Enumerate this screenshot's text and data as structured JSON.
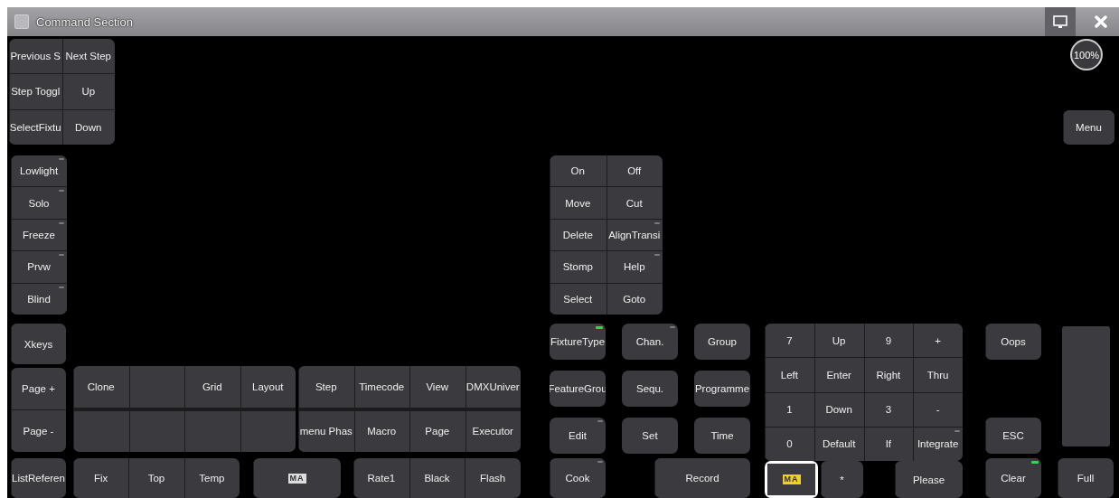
{
  "window": {
    "title": "Command Section"
  },
  "zoom_level": "100%",
  "groups": [
    {
      "keys": [
        {
          "kind": "key",
          "label": "Previous S",
          "indicator": false
        },
        {
          "kind": "key",
          "label": "Next Step",
          "indicator": false
        },
        {
          "kind": "key",
          "label": "Step Toggl",
          "indicator": false
        },
        {
          "kind": "key",
          "label": "Up",
          "indicator": false
        },
        {
          "kind": "key",
          "label": "SelectFixtu",
          "indicator": false
        },
        {
          "kind": "key",
          "label": "Down",
          "indicator": false
        }
      ]
    },
    {
      "keys": [
        {
          "kind": "key",
          "label": "Lowlight",
          "indicator": true,
          "lit": false
        },
        {
          "kind": "key",
          "label": "Solo",
          "indicator": true,
          "lit": false
        },
        {
          "kind": "key",
          "label": "Freeze",
          "indicator": true,
          "lit": false
        },
        {
          "kind": "key",
          "label": "Prvw",
          "indicator": true,
          "lit": false
        },
        {
          "kind": "key",
          "label": "Blind",
          "indicator": true,
          "lit": false
        }
      ]
    },
    {
      "keys": [
        {
          "kind": "key",
          "label": "Xkeys",
          "indicator": false
        }
      ]
    },
    {
      "keys": [
        {
          "kind": "key",
          "label": "Page +",
          "indicator": false
        },
        {
          "kind": "key",
          "label": "Page -",
          "indicator": false
        }
      ]
    },
    {
      "keys": [
        {
          "kind": "key",
          "label": "ListReferen",
          "indicator": false
        }
      ]
    },
    {
      "keys": [
        {
          "kind": "key",
          "label": "Clone",
          "indicator": false
        },
        {
          "kind": "blank",
          "indicator": false
        },
        {
          "kind": "key",
          "label": "Grid",
          "indicator": false
        },
        {
          "kind": "key",
          "label": "Layout",
          "indicator": false
        },
        {
          "kind": "blank",
          "indicator": false
        },
        {
          "kind": "blank",
          "indicator": false
        },
        {
          "kind": "blank",
          "indicator": false
        },
        {
          "kind": "blank",
          "indicator": false
        }
      ]
    },
    {
      "keys": [
        {
          "kind": "key",
          "label": "Step",
          "indicator": false
        },
        {
          "kind": "key",
          "label": "Timecode",
          "indicator": false
        },
        {
          "kind": "key",
          "label": "View",
          "indicator": false
        },
        {
          "kind": "key",
          "label": "DMXUniver",
          "indicator": false
        },
        {
          "kind": "key",
          "label": "menu Phas",
          "indicator": false
        },
        {
          "kind": "key",
          "label": "Macro",
          "indicator": false
        },
        {
          "kind": "key",
          "label": "Page",
          "indicator": false
        },
        {
          "kind": "key",
          "label": "Executor",
          "indicator": false
        }
      ]
    },
    {
      "keys": [
        {
          "kind": "key",
          "label": "Fix",
          "indicator": false
        },
        {
          "kind": "key",
          "label": "Top",
          "indicator": false
        },
        {
          "kind": "key",
          "label": "Temp",
          "indicator": false
        }
      ]
    },
    {
      "keys": [
        {
          "kind": "logo",
          "label": "MA",
          "selected": false,
          "indicator": false
        }
      ]
    },
    {
      "keys": [
        {
          "kind": "key",
          "label": "Rate1",
          "indicator": false
        },
        {
          "kind": "key",
          "label": "Black",
          "indicator": false
        },
        {
          "kind": "key",
          "label": "Flash",
          "indicator": false
        }
      ]
    },
    {
      "keys": [
        {
          "kind": "key",
          "label": "Menu",
          "indicator": false
        }
      ]
    },
    {
      "keys": [
        {
          "kind": "key",
          "label": "On",
          "indicator": false
        },
        {
          "kind": "key",
          "label": "Off",
          "indicator": false
        },
        {
          "kind": "key",
          "label": "Move",
          "indicator": false
        },
        {
          "kind": "key",
          "label": "Cut",
          "indicator": false
        },
        {
          "kind": "key",
          "label": "Delete",
          "indicator": false
        },
        {
          "kind": "key",
          "label": "AlignTransi",
          "indicator": true,
          "lit": false
        },
        {
          "kind": "key",
          "label": "Stomp",
          "indicator": false
        },
        {
          "kind": "key",
          "label": "Help",
          "indicator": true,
          "lit": false
        },
        {
          "kind": "key",
          "label": "Select",
          "indicator": false
        },
        {
          "kind": "key",
          "label": "Goto",
          "indicator": false
        }
      ]
    },
    {
      "keys": [
        {
          "kind": "key",
          "label": "FixtureType",
          "indicator": true,
          "lit": true
        },
        {
          "kind": "key",
          "label": "Chan.",
          "indicator": true,
          "lit": false
        },
        {
          "kind": "key",
          "label": "Group",
          "indicator": false
        },
        {
          "kind": "key",
          "label": "FeatureGrou",
          "indicator": false
        },
        {
          "kind": "key",
          "label": "Sequ.",
          "indicator": false
        },
        {
          "kind": "key",
          "label": "Programme",
          "indicator": false
        },
        {
          "kind": "key",
          "label": "Edit",
          "indicator": true,
          "lit": false
        },
        {
          "kind": "key",
          "label": "Set",
          "indicator": false
        },
        {
          "kind": "key",
          "label": "Time",
          "indicator": false
        }
      ]
    },
    {
      "keys": [
        {
          "kind": "key",
          "label": "Cook",
          "indicator": true,
          "lit": false
        }
      ]
    },
    {
      "keys": [
        {
          "kind": "key",
          "label": "Record",
          "indicator": false
        }
      ]
    },
    {
      "keys": [
        {
          "kind": "key",
          "label": "7",
          "indicator": false
        },
        {
          "kind": "key",
          "label": "Up",
          "indicator": false
        },
        {
          "kind": "key",
          "label": "9",
          "indicator": false
        },
        {
          "kind": "key",
          "label": "+",
          "indicator": false
        },
        {
          "kind": "key",
          "label": "Left",
          "indicator": false
        },
        {
          "kind": "key",
          "label": "Enter",
          "indicator": false
        },
        {
          "kind": "key",
          "label": "Right",
          "indicator": false
        },
        {
          "kind": "key",
          "label": "Thru",
          "indicator": false
        },
        {
          "kind": "key",
          "label": "1",
          "indicator": false
        },
        {
          "kind": "key",
          "label": "Down",
          "indicator": false
        },
        {
          "kind": "key",
          "label": "3",
          "indicator": false
        },
        {
          "kind": "key",
          "label": "-",
          "indicator": false
        },
        {
          "kind": "key",
          "label": "0",
          "indicator": false
        },
        {
          "kind": "key",
          "label": "Default",
          "indicator": false
        },
        {
          "kind": "key",
          "label": "If",
          "indicator": false
        },
        {
          "kind": "key",
          "label": "Integrate",
          "indicator": true,
          "lit": false
        }
      ]
    },
    {
      "keys": [
        {
          "kind": "logo",
          "label": "MA",
          "selected": true,
          "indicator": false
        }
      ]
    },
    {
      "keys": [
        {
          "kind": "key",
          "label": "*",
          "indicator": false
        }
      ]
    },
    {
      "keys": [
        {
          "kind": "key",
          "label": "Please",
          "indicator": false
        }
      ]
    },
    {
      "keys": [
        {
          "kind": "key",
          "label": "Oops",
          "indicator": false
        }
      ]
    },
    {
      "keys": [
        {
          "kind": "key",
          "label": "ESC",
          "indicator": false
        }
      ]
    },
    {
      "keys": [
        {
          "kind": "key",
          "label": "Clear",
          "indicator": true,
          "lit": true
        }
      ]
    },
    {
      "keys": [
        {
          "kind": "key",
          "label": "Full",
          "indicator": false
        }
      ]
    }
  ]
}
